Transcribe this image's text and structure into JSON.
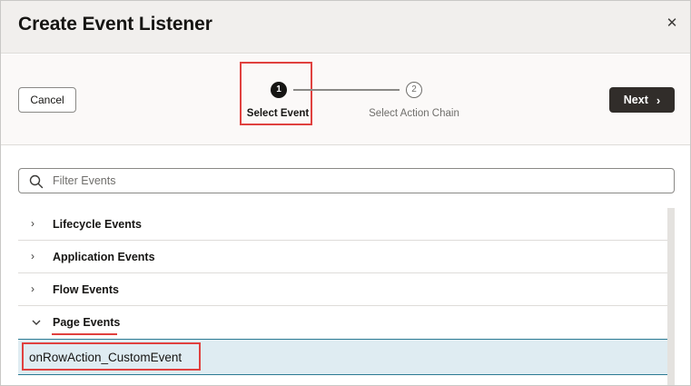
{
  "dialog": {
    "title": "Create Event Listener",
    "close_icon": "close-icon"
  },
  "toolbar": {
    "cancel_label": "Cancel",
    "next_label": "Next"
  },
  "train": {
    "steps": [
      {
        "number": "1",
        "label": "Select Event",
        "state": "current"
      },
      {
        "number": "2",
        "label": "Select Action Chain",
        "state": "upcoming"
      }
    ]
  },
  "search": {
    "placeholder": "Filter Events",
    "value": ""
  },
  "events": {
    "groups": [
      {
        "label": "Lifecycle Events",
        "expanded": false
      },
      {
        "label": "Application Events",
        "expanded": false
      },
      {
        "label": "Flow Events",
        "expanded": false
      },
      {
        "label": "Page Events",
        "expanded": true
      }
    ],
    "page_event_items": [
      {
        "label": "onRowAction_CustomEvent",
        "selected": true
      }
    ]
  },
  "colors": {
    "accent_highlight": "#e0413f",
    "selected_row_bg": "#dfecf2",
    "selected_row_border": "#2b7a93",
    "primary_button": "#312d2a"
  }
}
